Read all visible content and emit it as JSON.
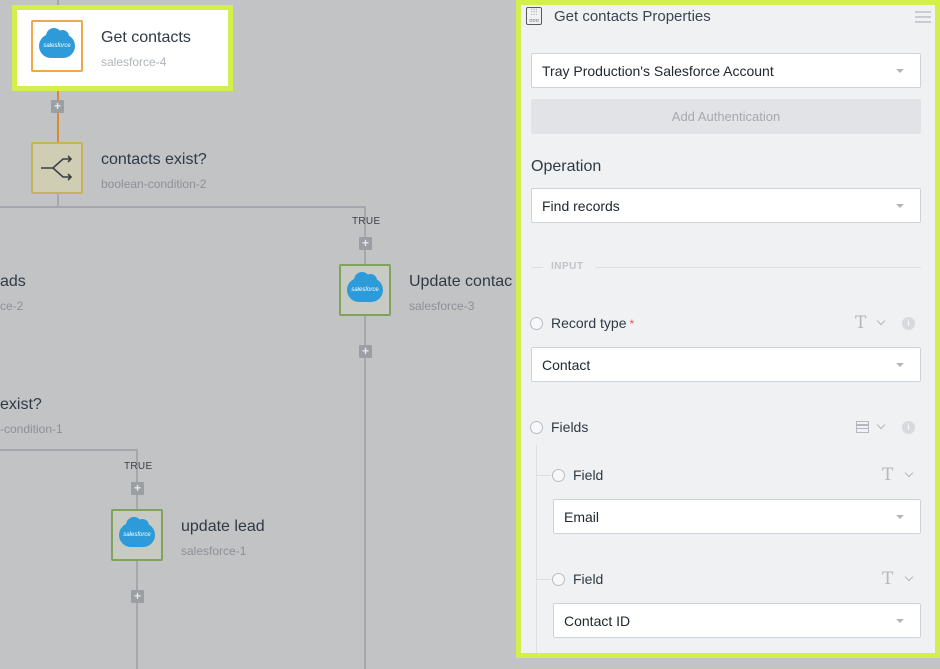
{
  "canvas": {
    "nodes": [
      {
        "title": "Get contacts",
        "subtitle": "salesforce-4"
      },
      {
        "title": "contacts exist?",
        "subtitle": "boolean-condition-2"
      },
      {
        "title": "ads",
        "subtitle": "ce-2"
      },
      {
        "title": "Update contac",
        "subtitle": "salesforce-3"
      },
      {
        "title": "exist?",
        "subtitle": "-condition-1"
      },
      {
        "title": "update lead",
        "subtitle": "salesforce-1"
      }
    ],
    "branch_true_1": "TRUE",
    "branch_true_2": "TRUE",
    "salesforce_logo_text": "salesforce",
    "plus_symbol": "+"
  },
  "panel": {
    "title": "Get contacts Properties",
    "account_select": "Tray Production's Salesforce Account",
    "add_auth_button": "Add Authentication",
    "operation_label": "Operation",
    "operation_select": "Find records",
    "input_divider": "INPUT",
    "record_type_label": "Record type",
    "required_mark": "*",
    "record_type_value": "Contact",
    "fields_label": "Fields",
    "field1_label": "Field",
    "field1_value": "Email",
    "field2_label": "Field",
    "field2_value": "Contact ID",
    "type_glyph": "T",
    "info_glyph": "i"
  },
  "colors": {
    "highlight": "#d2ef4d",
    "salesforce_blue": "#2d9bd9",
    "required": "#e8554e",
    "canvas_bg": "#c2c3c5"
  }
}
